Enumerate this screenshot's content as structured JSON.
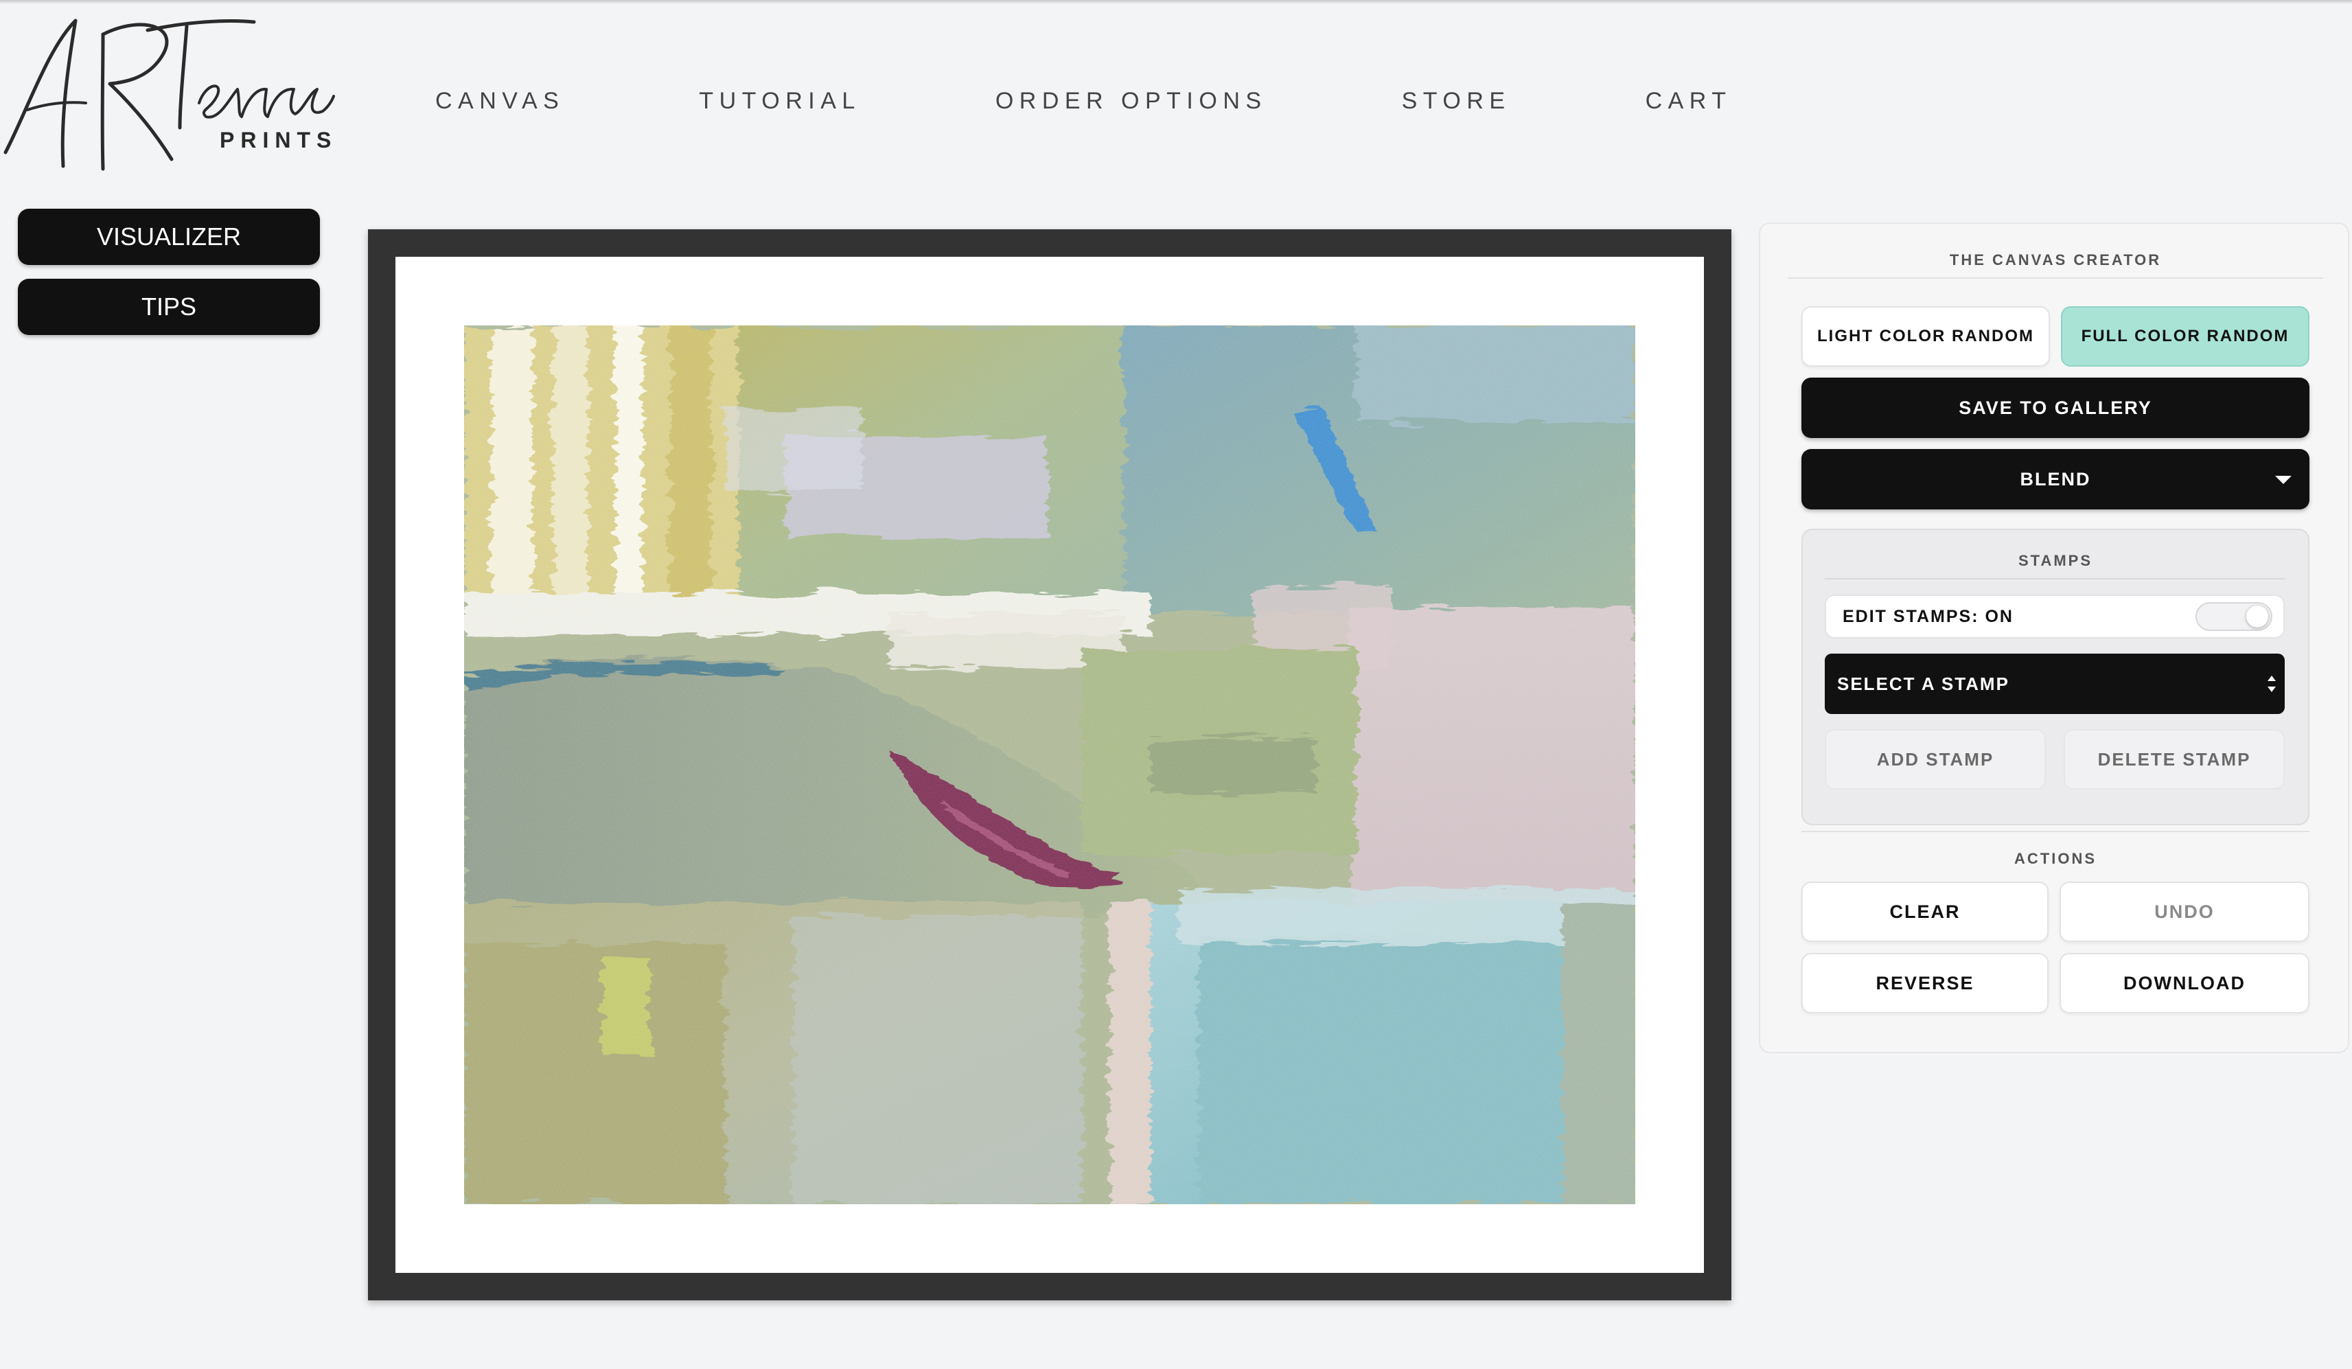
{
  "brand": {
    "script": "ARTerra",
    "sub": "PRINTS"
  },
  "nav": {
    "items": [
      "CANVAS",
      "TUTORIAL",
      "ORDER OPTIONS",
      "STORE",
      "CART"
    ]
  },
  "left_buttons": {
    "visualizer": "VISUALIZER",
    "tips": "TIPS"
  },
  "artwork": {
    "icon": "abstract-painting-image",
    "frame_color": "#333333",
    "mat_color": "#ffffff"
  },
  "panel": {
    "title": "THE CANVAS CREATOR",
    "light_random": "LIGHT COLOR RANDOM",
    "full_random": "FULL COLOR RANDOM",
    "save": "SAVE TO GALLERY",
    "blend": "BLEND",
    "stamps": {
      "title": "STAMPS",
      "edit_label": "EDIT STAMPS: ON",
      "edit_on": true,
      "select_placeholder": "SELECT A STAMP",
      "add": "ADD STAMP",
      "delete": "DELETE STAMP"
    },
    "actions": {
      "title": "ACTIONS",
      "clear": "CLEAR",
      "undo": "UNDO",
      "reverse": "REVERSE",
      "download": "DOWNLOAD"
    },
    "colors": {
      "accent_teal": "#a8e3d6",
      "dark": "#111111"
    }
  }
}
